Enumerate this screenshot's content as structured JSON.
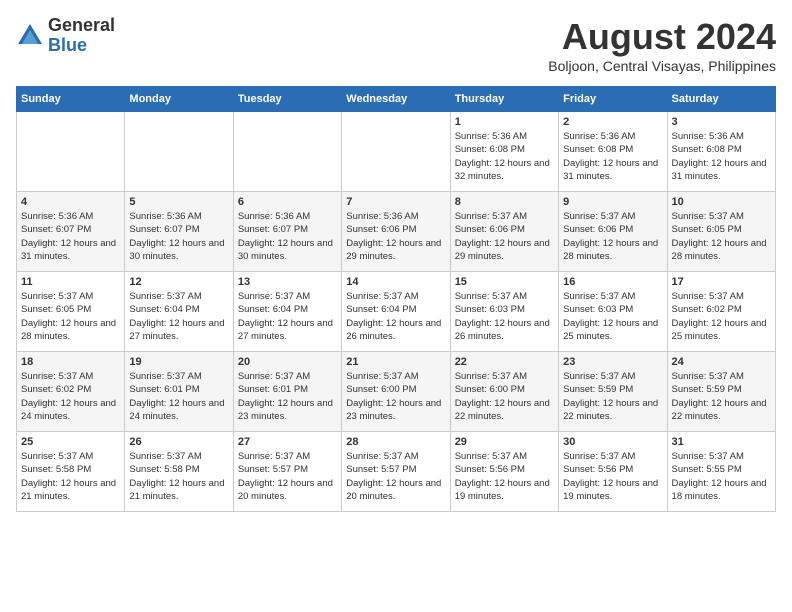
{
  "logo": {
    "general": "General",
    "blue": "Blue"
  },
  "title": "August 2024",
  "location": "Boljoon, Central Visayas, Philippines",
  "days_of_week": [
    "Sunday",
    "Monday",
    "Tuesday",
    "Wednesday",
    "Thursday",
    "Friday",
    "Saturday"
  ],
  "weeks": [
    [
      {
        "day": "",
        "sunrise": "",
        "sunset": "",
        "daylight": ""
      },
      {
        "day": "",
        "sunrise": "",
        "sunset": "",
        "daylight": ""
      },
      {
        "day": "",
        "sunrise": "",
        "sunset": "",
        "daylight": ""
      },
      {
        "day": "",
        "sunrise": "",
        "sunset": "",
        "daylight": ""
      },
      {
        "day": "1",
        "sunrise": "Sunrise: 5:36 AM",
        "sunset": "Sunset: 6:08 PM",
        "daylight": "Daylight: 12 hours and 32 minutes."
      },
      {
        "day": "2",
        "sunrise": "Sunrise: 5:36 AM",
        "sunset": "Sunset: 6:08 PM",
        "daylight": "Daylight: 12 hours and 31 minutes."
      },
      {
        "day": "3",
        "sunrise": "Sunrise: 5:36 AM",
        "sunset": "Sunset: 6:08 PM",
        "daylight": "Daylight: 12 hours and 31 minutes."
      }
    ],
    [
      {
        "day": "4",
        "sunrise": "Sunrise: 5:36 AM",
        "sunset": "Sunset: 6:07 PM",
        "daylight": "Daylight: 12 hours and 31 minutes."
      },
      {
        "day": "5",
        "sunrise": "Sunrise: 5:36 AM",
        "sunset": "Sunset: 6:07 PM",
        "daylight": "Daylight: 12 hours and 30 minutes."
      },
      {
        "day": "6",
        "sunrise": "Sunrise: 5:36 AM",
        "sunset": "Sunset: 6:07 PM",
        "daylight": "Daylight: 12 hours and 30 minutes."
      },
      {
        "day": "7",
        "sunrise": "Sunrise: 5:36 AM",
        "sunset": "Sunset: 6:06 PM",
        "daylight": "Daylight: 12 hours and 29 minutes."
      },
      {
        "day": "8",
        "sunrise": "Sunrise: 5:37 AM",
        "sunset": "Sunset: 6:06 PM",
        "daylight": "Daylight: 12 hours and 29 minutes."
      },
      {
        "day": "9",
        "sunrise": "Sunrise: 5:37 AM",
        "sunset": "Sunset: 6:06 PM",
        "daylight": "Daylight: 12 hours and 28 minutes."
      },
      {
        "day": "10",
        "sunrise": "Sunrise: 5:37 AM",
        "sunset": "Sunset: 6:05 PM",
        "daylight": "Daylight: 12 hours and 28 minutes."
      }
    ],
    [
      {
        "day": "11",
        "sunrise": "Sunrise: 5:37 AM",
        "sunset": "Sunset: 6:05 PM",
        "daylight": "Daylight: 12 hours and 28 minutes."
      },
      {
        "day": "12",
        "sunrise": "Sunrise: 5:37 AM",
        "sunset": "Sunset: 6:04 PM",
        "daylight": "Daylight: 12 hours and 27 minutes."
      },
      {
        "day": "13",
        "sunrise": "Sunrise: 5:37 AM",
        "sunset": "Sunset: 6:04 PM",
        "daylight": "Daylight: 12 hours and 27 minutes."
      },
      {
        "day": "14",
        "sunrise": "Sunrise: 5:37 AM",
        "sunset": "Sunset: 6:04 PM",
        "daylight": "Daylight: 12 hours and 26 minutes."
      },
      {
        "day": "15",
        "sunrise": "Sunrise: 5:37 AM",
        "sunset": "Sunset: 6:03 PM",
        "daylight": "Daylight: 12 hours and 26 minutes."
      },
      {
        "day": "16",
        "sunrise": "Sunrise: 5:37 AM",
        "sunset": "Sunset: 6:03 PM",
        "daylight": "Daylight: 12 hours and 25 minutes."
      },
      {
        "day": "17",
        "sunrise": "Sunrise: 5:37 AM",
        "sunset": "Sunset: 6:02 PM",
        "daylight": "Daylight: 12 hours and 25 minutes."
      }
    ],
    [
      {
        "day": "18",
        "sunrise": "Sunrise: 5:37 AM",
        "sunset": "Sunset: 6:02 PM",
        "daylight": "Daylight: 12 hours and 24 minutes."
      },
      {
        "day": "19",
        "sunrise": "Sunrise: 5:37 AM",
        "sunset": "Sunset: 6:01 PM",
        "daylight": "Daylight: 12 hours and 24 minutes."
      },
      {
        "day": "20",
        "sunrise": "Sunrise: 5:37 AM",
        "sunset": "Sunset: 6:01 PM",
        "daylight": "Daylight: 12 hours and 23 minutes."
      },
      {
        "day": "21",
        "sunrise": "Sunrise: 5:37 AM",
        "sunset": "Sunset: 6:00 PM",
        "daylight": "Daylight: 12 hours and 23 minutes."
      },
      {
        "day": "22",
        "sunrise": "Sunrise: 5:37 AM",
        "sunset": "Sunset: 6:00 PM",
        "daylight": "Daylight: 12 hours and 22 minutes."
      },
      {
        "day": "23",
        "sunrise": "Sunrise: 5:37 AM",
        "sunset": "Sunset: 5:59 PM",
        "daylight": "Daylight: 12 hours and 22 minutes."
      },
      {
        "day": "24",
        "sunrise": "Sunrise: 5:37 AM",
        "sunset": "Sunset: 5:59 PM",
        "daylight": "Daylight: 12 hours and 22 minutes."
      }
    ],
    [
      {
        "day": "25",
        "sunrise": "Sunrise: 5:37 AM",
        "sunset": "Sunset: 5:58 PM",
        "daylight": "Daylight: 12 hours and 21 minutes."
      },
      {
        "day": "26",
        "sunrise": "Sunrise: 5:37 AM",
        "sunset": "Sunset: 5:58 PM",
        "daylight": "Daylight: 12 hours and 21 minutes."
      },
      {
        "day": "27",
        "sunrise": "Sunrise: 5:37 AM",
        "sunset": "Sunset: 5:57 PM",
        "daylight": "Daylight: 12 hours and 20 minutes."
      },
      {
        "day": "28",
        "sunrise": "Sunrise: 5:37 AM",
        "sunset": "Sunset: 5:57 PM",
        "daylight": "Daylight: 12 hours and 20 minutes."
      },
      {
        "day": "29",
        "sunrise": "Sunrise: 5:37 AM",
        "sunset": "Sunset: 5:56 PM",
        "daylight": "Daylight: 12 hours and 19 minutes."
      },
      {
        "day": "30",
        "sunrise": "Sunrise: 5:37 AM",
        "sunset": "Sunset: 5:56 PM",
        "daylight": "Daylight: 12 hours and 19 minutes."
      },
      {
        "day": "31",
        "sunrise": "Sunrise: 5:37 AM",
        "sunset": "Sunset: 5:55 PM",
        "daylight": "Daylight: 12 hours and 18 minutes."
      }
    ]
  ]
}
